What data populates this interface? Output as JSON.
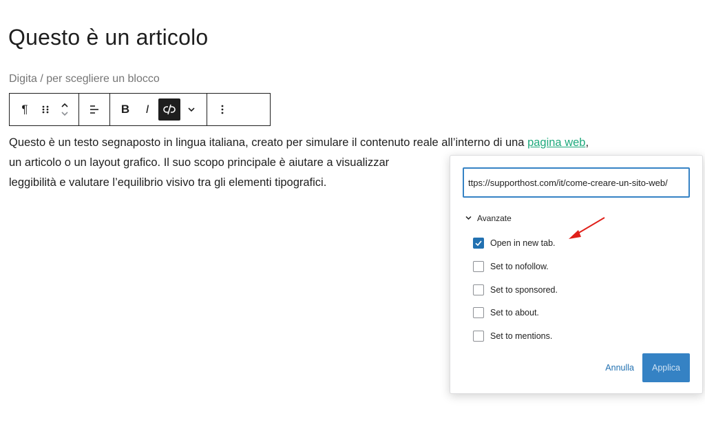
{
  "editor": {
    "post_title": "Questo è un articolo",
    "block_placeholder": "Digita / per scegliere un blocco",
    "paragraph": {
      "line1_before_link": "Questo è un testo segnaposto in lingua italiana, creato per simulare il contenuto reale all’interno di una ",
      "link_text": "pagina web",
      "line1_after_link": ",",
      "line2": "un articolo o un layout grafico. Il suo scopo principale è aiutare a visualizzar",
      "line3": "leggibilità e valutare l’equilibrio visivo tra gli elementi tipografici."
    }
  },
  "toolbar": {
    "paragraph_icon": "pilcrow-icon",
    "drag_icon": "drag-handle-icon",
    "move_icon": "move-up-down-icon",
    "align_icon": "align-left-icon",
    "bold_label": "B",
    "italic_label": "I",
    "link_icon": "unlink-icon",
    "more_icon": "chevron-down-icon",
    "options_icon": "more-vertical-icon"
  },
  "link_popover": {
    "url_value": "ttps://supporthost.com/it/come-creare-un-sito-web/",
    "advanced_label": "Avanzate",
    "options": [
      {
        "label": "Open in new tab.",
        "checked": true
      },
      {
        "label": "Set to nofollow.",
        "checked": false
      },
      {
        "label": "Set to sponsored.",
        "checked": false
      },
      {
        "label": "Set to about.",
        "checked": false
      },
      {
        "label": "Set to mentions.",
        "checked": false
      }
    ],
    "cancel_label": "Annulla",
    "apply_label": "Applica"
  },
  "colors": {
    "link_green": "#1ea97c",
    "wp_blue": "#2271b1",
    "annotation_arrow": "#e0201a"
  }
}
